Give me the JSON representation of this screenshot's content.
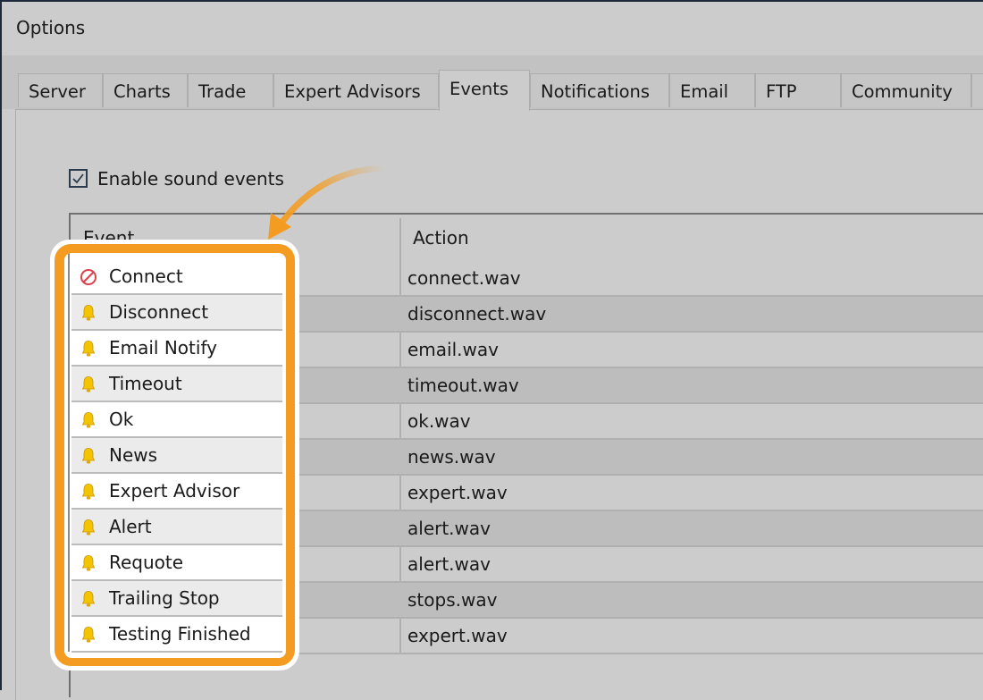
{
  "window": {
    "title": "Options"
  },
  "tabs": [
    {
      "label": "Server",
      "active": false
    },
    {
      "label": "Charts",
      "active": false
    },
    {
      "label": "Trade",
      "active": false
    },
    {
      "label": "Expert Advisors",
      "active": false
    },
    {
      "label": "Events",
      "active": true
    },
    {
      "label": "Notifications",
      "active": false
    },
    {
      "label": "Email",
      "active": false
    },
    {
      "label": "FTP",
      "active": false
    },
    {
      "label": "Community",
      "active": false
    }
  ],
  "events_tab": {
    "enable_sound": {
      "label": "Enable sound events",
      "checked": true
    },
    "table": {
      "columns": [
        "Event",
        "Action"
      ],
      "rows": [
        {
          "event": "Connect",
          "icon": "disabled-icon",
          "action": "connect.wav"
        },
        {
          "event": "Disconnect",
          "icon": "bell-icon",
          "action": "disconnect.wav"
        },
        {
          "event": "Email Notify",
          "icon": "bell-icon",
          "action": "email.wav"
        },
        {
          "event": "Timeout",
          "icon": "bell-icon",
          "action": "timeout.wav"
        },
        {
          "event": "Ok",
          "icon": "bell-icon",
          "action": "ok.wav"
        },
        {
          "event": "News",
          "icon": "bell-icon",
          "action": "news.wav"
        },
        {
          "event": "Expert Advisor",
          "icon": "bell-icon",
          "action": "expert.wav"
        },
        {
          "event": "Alert",
          "icon": "bell-icon",
          "action": "alert.wav"
        },
        {
          "event": "Requote",
          "icon": "bell-icon",
          "action": "alert.wav"
        },
        {
          "event": "Trailing Stop",
          "icon": "bell-icon",
          "action": "stops.wav"
        },
        {
          "event": "Testing Finished",
          "icon": "bell-icon",
          "action": "expert.wav"
        }
      ]
    }
  },
  "colors": {
    "highlight": "#f39c21",
    "bell": "#f5c400",
    "disabled": "#e0404a"
  }
}
